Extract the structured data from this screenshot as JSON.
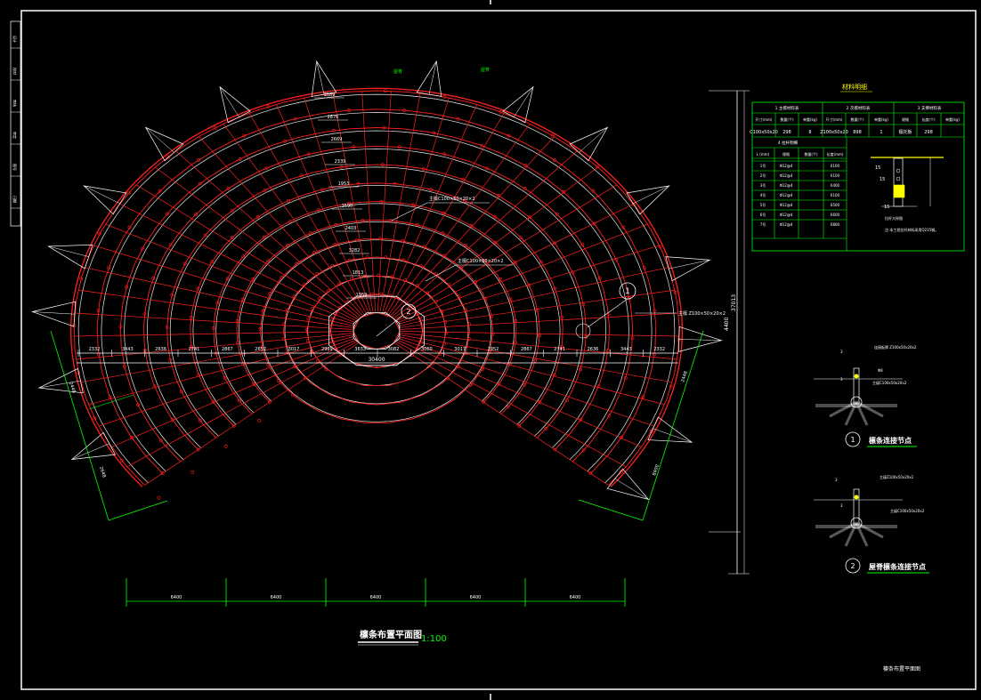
{
  "colors": {
    "background": "#000000",
    "purlin": "#ff2020",
    "rib": "#e8e8e8",
    "dimension": "#00ff00",
    "annotation": "#ffffff",
    "label": "#ffff00",
    "table": "#00ff00"
  },
  "drawing": {
    "title": "檩条布置平面图",
    "scale": "1:100",
    "sheet_label": "檩条布置平面图",
    "span_dim": "30400",
    "height_dim": "37013",
    "right_dim": "4400",
    "callout_1": "1",
    "callout_2": "2",
    "callout_1_note": "主檩 Z100×50×20×2",
    "purlin_note": "主檩C100×50×20×2",
    "purlin_note_2": "主檩C100×50×20×2",
    "vertical_dims": [
      "3389",
      "2876",
      "2669",
      "2339",
      "1953",
      "1590",
      "2403",
      "3282",
      "1813",
      "1959"
    ],
    "bottom_dims": [
      "6400",
      "6400",
      "6400",
      "6400",
      "6400"
    ],
    "span_dims": [
      "2332",
      "3443",
      "2636",
      "2741",
      "2867",
      "2652",
      "3017",
      "2969",
      "3633",
      "3082",
      "3060",
      "3017",
      "2952",
      "2867",
      "2741",
      "2636",
      "3443",
      "2332"
    ],
    "left_diag_dims": [
      "2448",
      "2648"
    ],
    "right_diag_dims": [
      "2448",
      "8400"
    ],
    "tag_labels": [
      "屋脊",
      "屋脊"
    ]
  },
  "materials_table": {
    "title": "材料明细",
    "section_headers": [
      "1 主檩材料表",
      "2 次檩材料表",
      "3 支撑材料表"
    ],
    "row_headers": [
      "尺寸(mm)",
      "数量(个)",
      "单重(kg)",
      "尺寸(mm)",
      "数量(个)",
      "单重(kg)",
      "规格",
      "长度(个)",
      "单重(kg)"
    ],
    "row_values": [
      "C100x50x20",
      "298",
      "8",
      "Z100x50x20",
      "898",
      "1",
      "檩托板",
      "298"
    ],
    "sub_title": "4 拉杆明细",
    "sub_headers": [
      "L (mm)",
      "规格",
      "数量(个)",
      "长度(mm)"
    ],
    "sub_rows": [
      [
        "1号",
        "Φ12@4",
        "",
        "6100"
      ],
      [
        "2号",
        "Φ12@4",
        "",
        "6100"
      ],
      [
        "3号",
        "Φ12@4",
        "",
        "6400"
      ],
      [
        "4号",
        "Φ12@4",
        "",
        "6100"
      ],
      [
        "5号",
        "Φ12@4",
        "",
        "6500"
      ],
      [
        "6号",
        "Φ12@4",
        "",
        "6600"
      ],
      [
        "7号",
        "Φ12@4",
        "",
        "6800"
      ]
    ],
    "detail_note_1": "拉杆大样图",
    "detail_note_2": "注:本工程拉杆材料采用Q235钢。",
    "detail_dims": [
      "15",
      "15",
      "15"
    ]
  },
  "details": {
    "detail_1_title": "檩条连接节点",
    "detail_2_title": "屋脊檩条连接节点",
    "detail_1_num": "1",
    "detail_2_num": "2",
    "detail_1_notes": [
      "连接板厚 Z100x50x20x2",
      "主檩C100x50x20x2",
      "Φ8",
      "3",
      "3"
    ],
    "detail_2_notes": [
      "主檩Z100x50x20x2",
      "主檩C100x50x20x2",
      "3",
      "3"
    ]
  },
  "side_block": {
    "labels": [
      "设计",
      "校对",
      "审核",
      "审定",
      "图号",
      "日期"
    ]
  }
}
